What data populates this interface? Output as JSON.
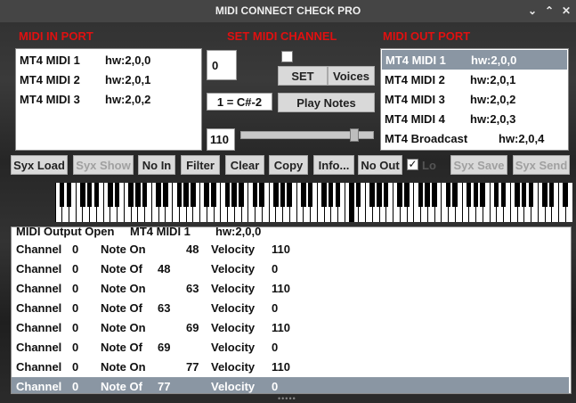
{
  "window": {
    "title": "MIDI CONNECT CHECK PRO"
  },
  "labels": {
    "midi_in": "MIDI IN PORT",
    "set_channel": "SET MIDI CHANNEL",
    "midi_out": "MIDI OUT PORT"
  },
  "in_ports": [
    {
      "name": "MT4 MIDI 1",
      "hw": "hw:2,0,0"
    },
    {
      "name": "MT4 MIDI 2",
      "hw": "hw:2,0,1"
    },
    {
      "name": "MT4 MIDI 3",
      "hw": "hw:2,0,2"
    }
  ],
  "out_ports": [
    {
      "name": "MT4 MIDI 1",
      "hw": "hw:2,0,0",
      "selected": true
    },
    {
      "name": "MT4 MIDI 2",
      "hw": "hw:2,0,1"
    },
    {
      "name": "MT4 MIDI 3",
      "hw": "hw:2,0,2"
    },
    {
      "name": "MT4 MIDI 4",
      "hw": "hw:2,0,3"
    },
    {
      "name": "MT4 Broadcast",
      "hw": "hw:2,0,4"
    }
  ],
  "channel": {
    "value": "0",
    "set": "SET",
    "voices": "Voices",
    "note_display": "1 = C#-2",
    "play_notes": "Play Notes",
    "velocity_value": "110",
    "velocity_level": 0.88
  },
  "toolbar": [
    {
      "id": "syx-load",
      "label": "Syx Load",
      "enabled": true
    },
    {
      "id": "syx-show",
      "label": "Syx Show",
      "enabled": false
    },
    {
      "id": "no-in",
      "label": "No In",
      "enabled": true
    },
    {
      "id": "filter",
      "label": "Filter",
      "enabled": true
    },
    {
      "id": "clear",
      "label": "Clear",
      "enabled": true
    },
    {
      "id": "copy",
      "label": "Copy",
      "enabled": true
    },
    {
      "id": "info",
      "label": "Info...",
      "enabled": true
    },
    {
      "id": "no-out",
      "label": "No Out",
      "enabled": true
    },
    {
      "id": "syx-save",
      "label": "Syx Save",
      "enabled": false
    },
    {
      "id": "syx-send",
      "label": "Syx Send",
      "enabled": false
    }
  ],
  "log_header": {
    "text": "MIDI Output Open",
    "port": "MT4 MIDI 1",
    "hw": "hw:2,0,0"
  },
  "log": [
    {
      "a": "Channel",
      "ch": "0",
      "ev": "Note On",
      "n1": "",
      "n2": "48",
      "vl": "Velocity",
      "v": "110"
    },
    {
      "a": "Channel",
      "ch": "0",
      "ev": "Note Of",
      "n1": "48",
      "n2": "",
      "vl": "Velocity",
      "v": "0"
    },
    {
      "a": "Channel",
      "ch": "0",
      "ev": "Note On",
      "n1": "",
      "n2": "63",
      "vl": "Velocity",
      "v": "110"
    },
    {
      "a": "Channel",
      "ch": "0",
      "ev": "Note Of",
      "n1": "63",
      "n2": "",
      "vl": "Velocity",
      "v": "0"
    },
    {
      "a": "Channel",
      "ch": "0",
      "ev": "Note On",
      "n1": "",
      "n2": "69",
      "vl": "Velocity",
      "v": "110"
    },
    {
      "a": "Channel",
      "ch": "0",
      "ev": "Note Of",
      "n1": "69",
      "n2": "",
      "vl": "Velocity",
      "v": "0"
    },
    {
      "a": "Channel",
      "ch": "0",
      "ev": "Note On",
      "n1": "",
      "n2": "77",
      "vl": "Velocity",
      "v": "110"
    },
    {
      "a": "Channel",
      "ch": "0",
      "ev": "Note Of",
      "n1": "77",
      "n2": "",
      "vl": "Velocity",
      "v": "0",
      "selected": true
    }
  ],
  "keyboard": {
    "active_key": "middle"
  },
  "colors": {
    "label_red": "#e01010",
    "selection": "#8a96a3"
  }
}
